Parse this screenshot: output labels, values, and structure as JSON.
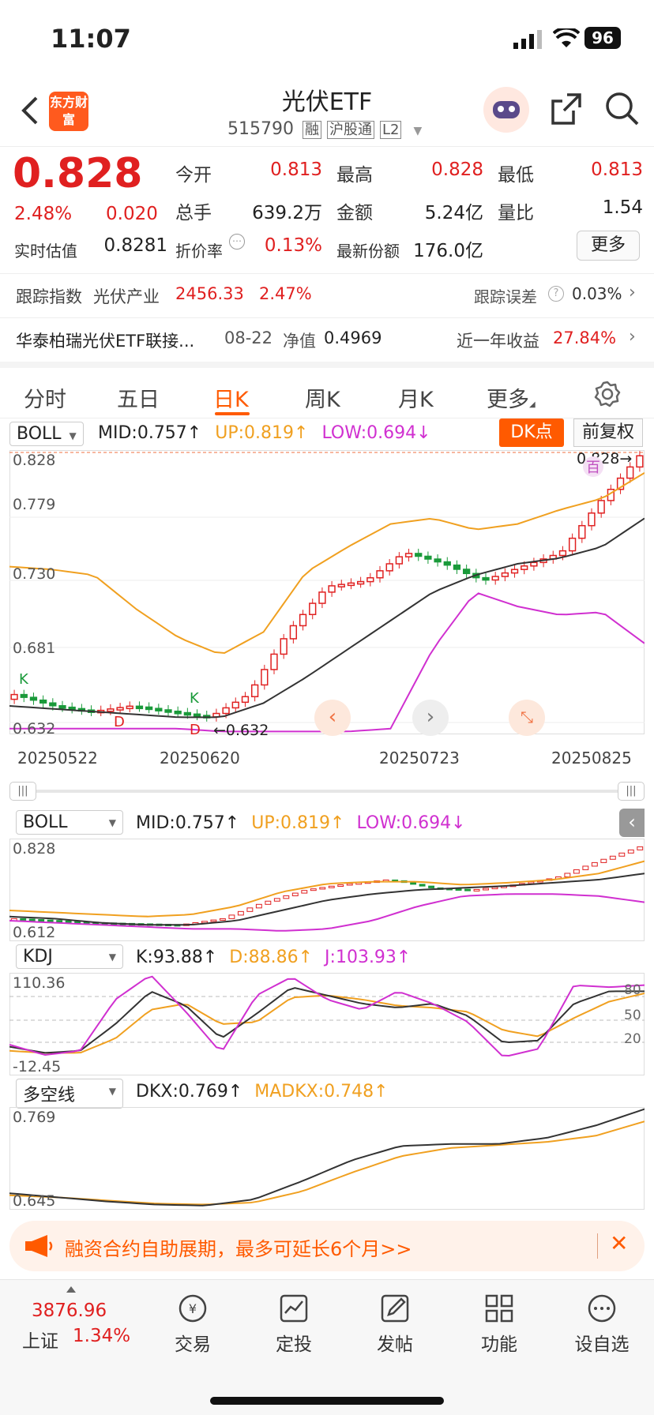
{
  "status": {
    "time": "11:07",
    "battery": "96"
  },
  "header": {
    "title": "光伏ETF",
    "code": "515790",
    "tags": [
      "融",
      "沪股通",
      "L2"
    ],
    "logo_text": "东方财富"
  },
  "quote": {
    "price": "0.828",
    "change_pct": "2.48%",
    "change": "0.020",
    "open_label": "今开",
    "open": "0.813",
    "high_label": "最高",
    "high": "0.828",
    "low_label": "最低",
    "low": "0.813",
    "vol_label": "总手",
    "vol": "639.2万",
    "amount_label": "金额",
    "amount": "5.24亿",
    "ratio_label": "量比",
    "ratio": "1.54",
    "est_label": "实时估值",
    "est": "0.8281",
    "premium_label": "折价率",
    "premium": "0.13%",
    "share_label": "最新份额",
    "share": "176.0亿",
    "more_label": "更多"
  },
  "tracking": {
    "index_label": "跟踪指数",
    "index_name": "光伏产业",
    "index_value": "2456.33",
    "index_pct": "2.47%",
    "error_label": "跟踪误差",
    "error_value": "0.03%",
    "fund_name": "华泰柏瑞光伏ETF联接...",
    "nav_date": "08-22",
    "nav_label": "净值",
    "nav_value": "0.4969",
    "year_label": "近一年收益",
    "year_value": "27.84%"
  },
  "tabs": [
    "分时",
    "五日",
    "日K",
    "周K",
    "月K",
    "更多"
  ],
  "active_tab": "日K",
  "main_chart": {
    "indicator": "BOLL",
    "mid": "MID:0.757↑",
    "up": "UP:0.819↑",
    "low": "LOW:0.694↓",
    "dk_label": "DK点",
    "fq_label": "前复权",
    "y_labels": [
      "0.828",
      "0.779",
      "0.730",
      "0.681",
      "0.632"
    ],
    "x_labels": [
      "20250522",
      "20250620",
      "20250723",
      "20250825"
    ],
    "max_label": "0.828→",
    "min_label": "←0.632",
    "buy_sell": [
      "K",
      "D",
      "K",
      "D",
      "百"
    ]
  },
  "boll_panel": {
    "indicator": "BOLL",
    "mid": "MID:0.757↑",
    "up": "UP:0.819↑",
    "low": "LOW:0.694↓",
    "y_top": "0.828",
    "y_bottom": "0.612"
  },
  "kdj_panel": {
    "indicator": "KDJ",
    "k": "K:93.88↑",
    "d": "D:88.86↑",
    "j": "J:103.93↑",
    "y_top": "110.36",
    "y_bottom": "-12.45",
    "levels": [
      "80",
      "50",
      "20"
    ]
  },
  "dkx_panel": {
    "indicator": "多空线",
    "dkx": "DKX:0.769↑",
    "madkx": "MADKX:0.748↑",
    "y_top": "0.769",
    "y_bottom": "0.645"
  },
  "banner": {
    "text": "融资合约自助展期，最多可延长6个月>>"
  },
  "bottom_bar": {
    "index_value": "3876.96",
    "index_name": "上证",
    "index_pct": "1.34%",
    "items": [
      "交易",
      "定投",
      "发帖",
      "功能",
      "设自选"
    ]
  },
  "colors": {
    "up": "#e02020",
    "down": "#1a9a3a",
    "mid": "#333333",
    "upper": "#f0a020",
    "lower": "#d030d0",
    "accent": "#ff5a00"
  }
}
